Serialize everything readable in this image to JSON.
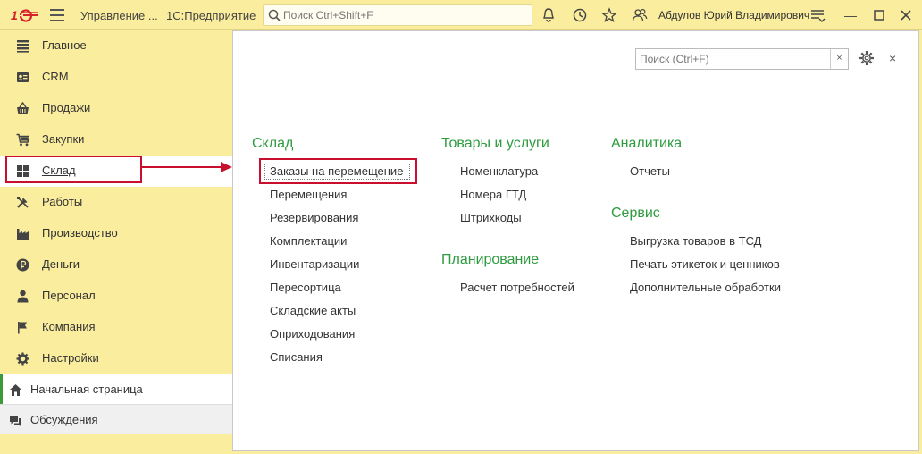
{
  "titlebar": {
    "app_name": "Управление ...",
    "platform": "1С:Предприятие",
    "search_placeholder": "Поиск Ctrl+Shift+F",
    "user": "Абдулов Юрий Владимирович"
  },
  "sidebar": {
    "items": [
      {
        "label": "Главное",
        "icon": "list-icon"
      },
      {
        "label": "CRM",
        "icon": "crm-icon"
      },
      {
        "label": "Продажи",
        "icon": "basket-icon"
      },
      {
        "label": "Закупки",
        "icon": "cart-icon"
      },
      {
        "label": "Склад",
        "icon": "warehouse-icon"
      },
      {
        "label": "Работы",
        "icon": "tools-icon"
      },
      {
        "label": "Производство",
        "icon": "factory-icon"
      },
      {
        "label": "Деньги",
        "icon": "ruble-icon"
      },
      {
        "label": "Персонал",
        "icon": "person-icon"
      },
      {
        "label": "Компания",
        "icon": "flag-icon"
      },
      {
        "label": "Настройки",
        "icon": "gear-icon"
      }
    ],
    "home": "Начальная страница",
    "discussions": "Обсуждения"
  },
  "main": {
    "search_placeholder": "Поиск (Ctrl+F)",
    "clear": "×",
    "close": "×",
    "sections": {
      "sklad": {
        "title": "Склад",
        "links": [
          "Заказы на перемещение",
          "Перемещения",
          "Резервирования",
          "Комплектации",
          "Инвентаризации",
          "Пересортица",
          "Складские акты",
          "Оприходования",
          "Списания"
        ]
      },
      "goods": {
        "title": "Товары и услуги",
        "links": [
          "Номенклатура",
          "Номера ГТД",
          "Штрихкоды"
        ]
      },
      "planning": {
        "title": "Планирование",
        "links": [
          "Расчет потребностей"
        ]
      },
      "analytics": {
        "title": "Аналитика",
        "links": [
          "Отчеты"
        ]
      },
      "service": {
        "title": "Сервис",
        "links": [
          "Выгрузка товаров в ТСД",
          "Печать этикеток и ценников",
          "Дополнительные обработки"
        ]
      }
    }
  }
}
